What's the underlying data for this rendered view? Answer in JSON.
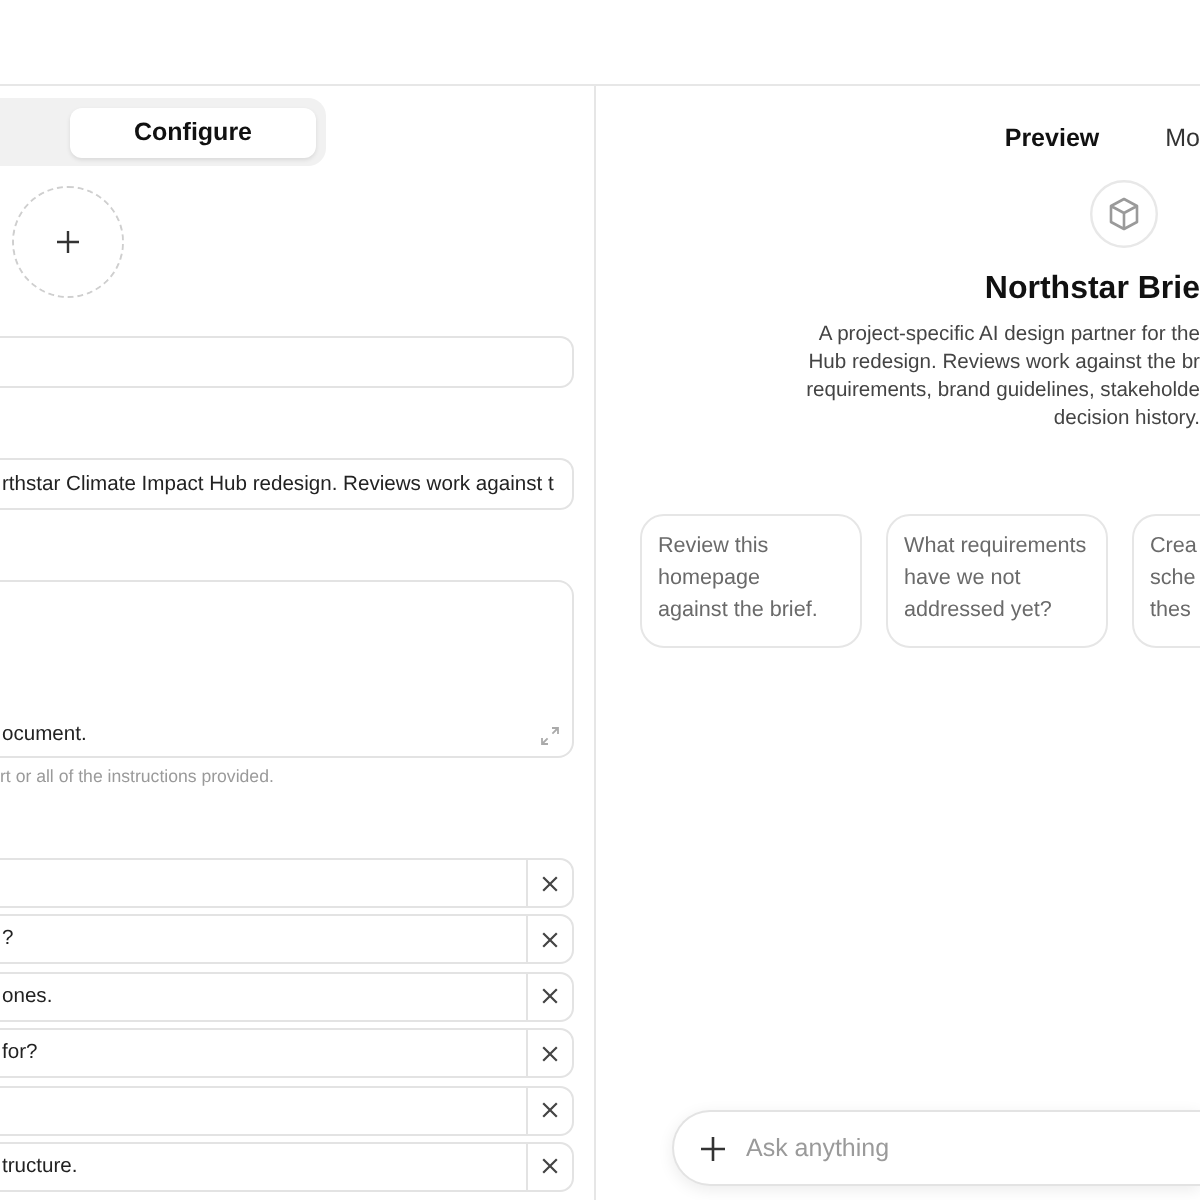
{
  "config_panel": {
    "tabs": [
      {
        "label": "Configure",
        "selected": true
      }
    ],
    "fields": [
      {
        "kind": "input"
      },
      {
        "kind": "input",
        "value": "rthstar Climate Impact Hub redesign. Reviews work against t"
      },
      {
        "kind": "textarea",
        "value": "ocument.",
        "hint": "rt or all of the instructions provided."
      }
    ],
    "conversation_starters": [
      {
        "kind": "blank"
      },
      {
        "kind": "text",
        "value": "?"
      },
      {
        "kind": "text",
        "value": "ones."
      },
      {
        "kind": "text",
        "value": "for?"
      },
      {
        "kind": "blank"
      },
      {
        "kind": "text",
        "value": "tructure."
      }
    ]
  },
  "preview_panel": {
    "tabs": [
      {
        "label": "Preview",
        "selected": true
      },
      {
        "label": "Mo",
        "selected": false
      }
    ],
    "title": "Northstar Brie",
    "description_lines": [
      "A project-specific AI design partner for the",
      "Hub redesign. Reviews work against the br",
      "requirements, brand guidelines, stakeholde",
      "decision history."
    ],
    "suggestions": [
      {
        "lines": [
          "Review this",
          "homepage",
          "against the brief."
        ]
      },
      {
        "lines": [
          "What requirements",
          "have we not",
          "addressed yet?"
        ]
      },
      {
        "lines": [
          "Crea",
          "sche",
          "thes"
        ]
      }
    ],
    "chat_input": {
      "placeholder": "Ask anything"
    }
  }
}
